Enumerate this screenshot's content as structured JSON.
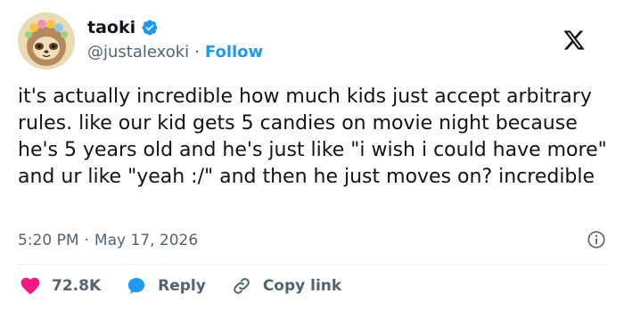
{
  "user": {
    "display_name": "taoki",
    "handle": "@justalexoki",
    "follow_label": "Follow",
    "separator": "·"
  },
  "tweet": {
    "text": "it's actually incredible how much kids just accept arbitrary rules. like our kid gets 5 candies on movie night because he's 5 years old and he's just like \"i wish i could have more\" and ur like \"yeah :/\" and then he just moves on? incredible",
    "time": "5:20 PM",
    "date": "May 17, 2026",
    "separator": "·"
  },
  "actions": {
    "likes": "72.8K",
    "reply_label": "Reply",
    "copy_link_label": "Copy link"
  },
  "colors": {
    "accent": "#1d9bf0",
    "like": "#f91880",
    "text": "#0f1419",
    "muted": "#536471"
  },
  "icons": {
    "avatar": "sloth-with-flower-crown",
    "verified": "verified-badge-icon",
    "platform": "x-logo-icon",
    "info": "info-icon",
    "like": "heart-icon",
    "reply": "speech-bubble-icon",
    "copy": "link-icon"
  }
}
